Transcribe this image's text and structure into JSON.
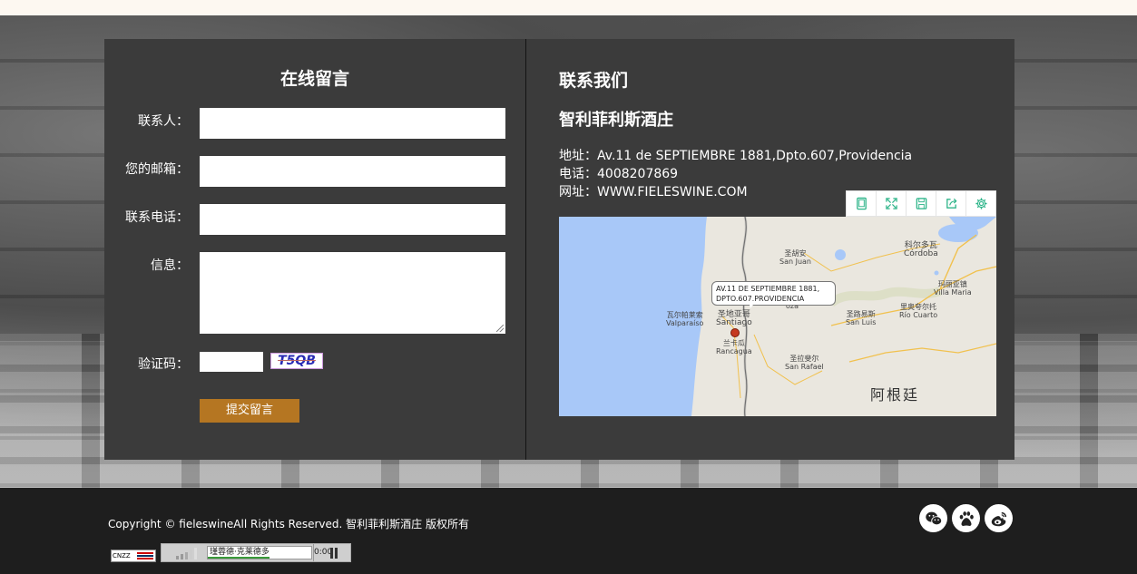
{
  "form": {
    "title": "在线留言",
    "contact_label": "联系人：",
    "email_label": "您的邮箱：",
    "phone_label": "联系电话：",
    "message_label": "信息：",
    "captcha_label": "验证码：",
    "captcha_code": "T5QB",
    "submit_label": "提交留言"
  },
  "contact": {
    "title": "联系我们",
    "company": "智利菲利斯酒庄",
    "address": "地址：Av.11 de SEPTIEMBRE 1881,Dpto.607,Providencia",
    "phone": "电话：4008207869",
    "website": "网址：WWW.FIELESWINE.COM"
  },
  "map": {
    "callout_line1": "AV.11 DE SEPTIEMBRE 1881,",
    "callout_line2": "DPTO.607,PROVIDENCIA",
    "labels": {
      "san_juan_zh": "圣胡安",
      "san_juan": "San Juan",
      "cordoba_zh": "科尔多瓦",
      "cordoba": "Córdoba",
      "villa_maria_zh": "玛丽亚镇",
      "villa_maria": "Villa Maria",
      "valparaiso_zh": "瓦尔帕莱索",
      "valparaiso": "Valparaíso",
      "santiago_zh": "圣地亚哥",
      "santiago": "Santiago",
      "mendoza": "oza",
      "san_luis_zh": "圣路易斯",
      "san_luis": "San Luis",
      "rio_cuarto_zh": "里奥夸尔托",
      "rio_cuarto": "Río Cuarto",
      "rancagua_zh": "兰卡瓜",
      "rancagua": "Rancagua",
      "san_rafael_zh": "圣拉斐尔",
      "san_rafael": "San Rafael",
      "argentina": "阿根廷"
    },
    "toolbar_icons": [
      "tablet-icon",
      "fullscreen-icon",
      "save-icon",
      "share-icon",
      "settings-icon"
    ],
    "accent_color": "#2fb58a"
  },
  "footer": {
    "copyright": "Copyright © fieleswineAll Rights Reserved. 智利菲利斯酒庄 版权所有",
    "cnzz": "CNZZ",
    "player_track": "瑾蓉德·克莱德多",
    "player_time": "0:00",
    "social_icons": [
      "wechat-icon",
      "baidu-icon",
      "weibo-icon"
    ]
  }
}
